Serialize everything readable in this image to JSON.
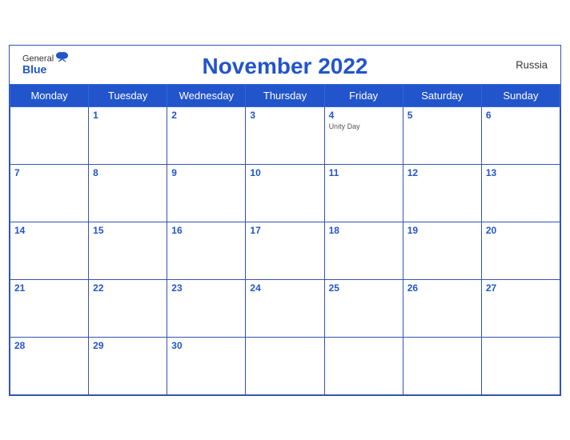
{
  "header": {
    "logo_general": "General",
    "logo_blue": "Blue",
    "month_title": "November 2022",
    "country": "Russia"
  },
  "days_of_week": [
    "Monday",
    "Tuesday",
    "Wednesday",
    "Thursday",
    "Friday",
    "Saturday",
    "Sunday"
  ],
  "weeks": [
    [
      {
        "day": "",
        "empty": true
      },
      {
        "day": "1"
      },
      {
        "day": "2"
      },
      {
        "day": "3"
      },
      {
        "day": "4",
        "event": "Unity Day"
      },
      {
        "day": "5"
      },
      {
        "day": "6"
      }
    ],
    [
      {
        "day": "7"
      },
      {
        "day": "8"
      },
      {
        "day": "9"
      },
      {
        "day": "10"
      },
      {
        "day": "11"
      },
      {
        "day": "12"
      },
      {
        "day": "13"
      }
    ],
    [
      {
        "day": "14"
      },
      {
        "day": "15"
      },
      {
        "day": "16"
      },
      {
        "day": "17"
      },
      {
        "day": "18"
      },
      {
        "day": "19"
      },
      {
        "day": "20"
      }
    ],
    [
      {
        "day": "21"
      },
      {
        "day": "22"
      },
      {
        "day": "23"
      },
      {
        "day": "24"
      },
      {
        "day": "25"
      },
      {
        "day": "26"
      },
      {
        "day": "27"
      }
    ],
    [
      {
        "day": "28"
      },
      {
        "day": "29"
      },
      {
        "day": "30"
      },
      {
        "day": "",
        "empty": true
      },
      {
        "day": "",
        "empty": true
      },
      {
        "day": "",
        "empty": true
      },
      {
        "day": "",
        "empty": true
      }
    ]
  ]
}
